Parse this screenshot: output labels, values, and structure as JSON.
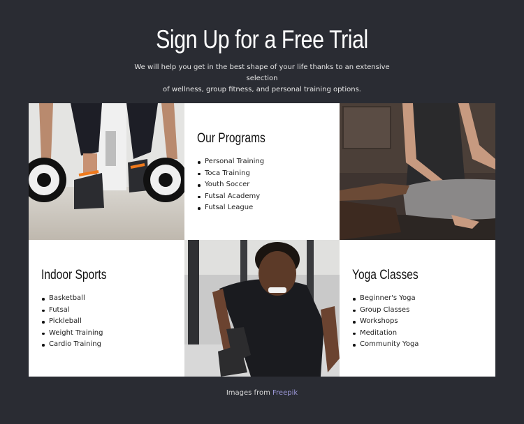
{
  "header": {
    "title": "Sign Up for a Free Trial",
    "subtitle_line1": "We will help you get in the best shape of your life thanks to an extensive selection",
    "subtitle_line2": "of wellness, group fitness, and personal training options."
  },
  "grid": {
    "images": [
      {
        "alt": "Person with dumbbells and orange-laced sneakers"
      },
      {
        "alt": "Woman meditating in yoga pose"
      },
      {
        "alt": "Man lifting dumbbell in gym"
      }
    ],
    "programs": {
      "title": "Our Programs",
      "items": [
        "Personal Training",
        "Toca Training",
        "Youth Soccer",
        "Futsal Academy",
        "Futsal League"
      ]
    },
    "indoor_sports": {
      "title": "Indoor Sports",
      "items": [
        "Basketball",
        "Futsal",
        "Pickleball",
        "Weight Training",
        "Cardio Training"
      ]
    },
    "yoga": {
      "title": "Yoga Classes",
      "items": [
        "Beginner's Yoga",
        "Group Classes",
        "Workshops",
        "Meditation",
        "Community Yoga"
      ]
    }
  },
  "footer": {
    "prefix": "Images from ",
    "link_text": "Freepik"
  },
  "colors": {
    "background": "#2a2c33",
    "link": "#9b98d8",
    "card": "#ffffff"
  }
}
